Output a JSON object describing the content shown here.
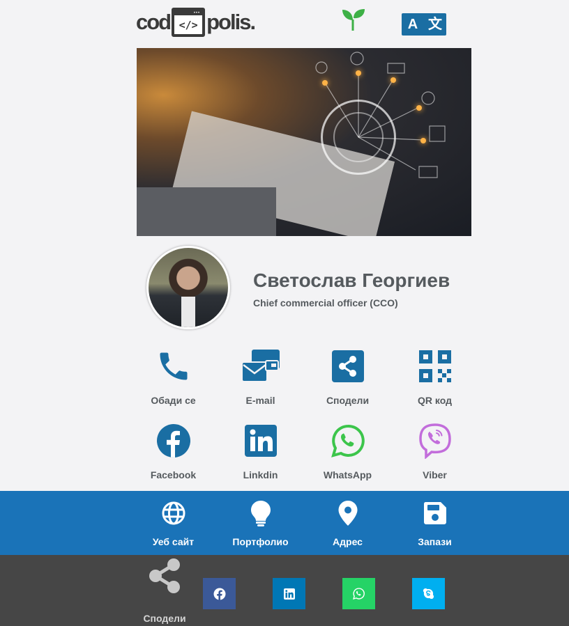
{
  "header": {
    "logo_left": "cod",
    "logo_code": "</>",
    "logo_right": "polis.",
    "lang_a": "A",
    "lang_b": "文"
  },
  "profile": {
    "name": "Светослав Георгиев",
    "role": "Chief commercial officer (CCO)"
  },
  "actions_row1": [
    {
      "label": "Обади се",
      "icon": "phone-icon"
    },
    {
      "label": "E-mail",
      "icon": "email-icon"
    },
    {
      "label": "Сподели",
      "icon": "share-icon"
    },
    {
      "label": "QR код",
      "icon": "qr-code-icon"
    }
  ],
  "actions_row2": [
    {
      "label": "Facebook",
      "icon": "facebook-icon"
    },
    {
      "label": "Linkdin",
      "icon": "linkedin-icon"
    },
    {
      "label": "WhatsApp",
      "icon": "whatsapp-icon"
    },
    {
      "label": "Viber",
      "icon": "viber-icon"
    }
  ],
  "blue_bar": [
    {
      "label": "Уеб сайт",
      "icon": "globe-icon"
    },
    {
      "label": "Портфолио",
      "icon": "lightbulb-icon"
    },
    {
      "label": "Адрес",
      "icon": "map-pin-icon"
    },
    {
      "label": "Запази",
      "icon": "save-icon"
    }
  ],
  "share_bar": {
    "label": "Сподели",
    "buttons": [
      {
        "icon": "facebook-icon",
        "color": "#3b5998"
      },
      {
        "icon": "linkedin-icon",
        "color": "#0077b5"
      },
      {
        "icon": "whatsapp-icon",
        "color": "#25d366"
      },
      {
        "icon": "skype-icon",
        "color": "#00aff0"
      }
    ]
  },
  "colors": {
    "primary": "#1a6ea3",
    "blue_bar": "#1a73b8",
    "dark_bar": "#464646",
    "text": "#555a5e",
    "sprout": "#3db046",
    "whatsapp": "#3cc54b",
    "viber": "#c26ddb"
  }
}
